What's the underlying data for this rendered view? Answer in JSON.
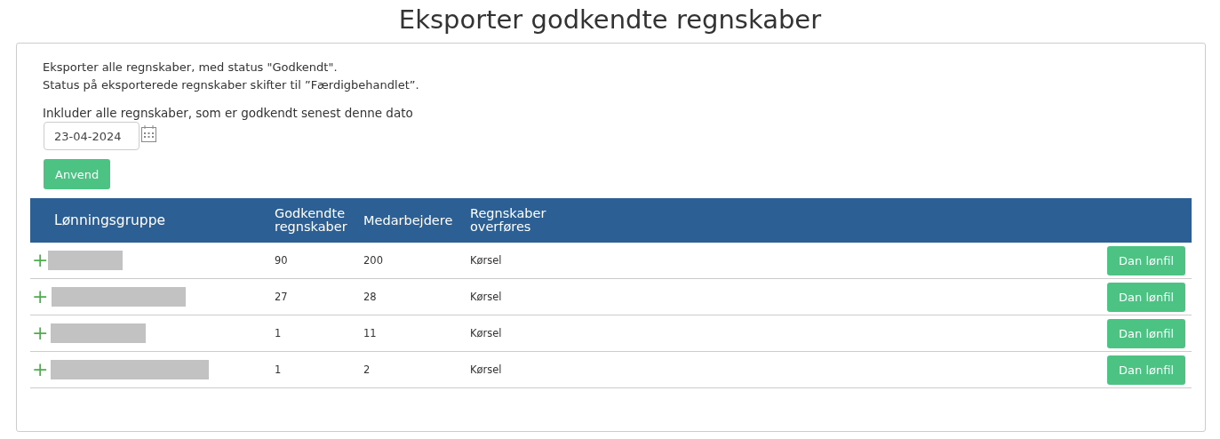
{
  "title": "Eksporter godkendte regnskaber",
  "intro": [
    "Eksporter alle regnskaber, med status \"Godkendt\".",
    "Status på eksporterede regnskaber skifter til ”Færdigbehandlet”."
  ],
  "date_label": "Inkluder alle regnskaber, som er godkendt senest denne dato",
  "date_field": {
    "value": "23-04-2024"
  },
  "apply_button": "Anvend",
  "table": {
    "columns": [
      "Lønningsgruppe",
      "Godkendte regnskaber",
      "Medarbejdere",
      "Regnskaber overføres"
    ],
    "rows": [
      {
        "expand": "+",
        "approved": "90",
        "employees": "200",
        "transfer": "Kørsel",
        "action": "Dan lønfil"
      },
      {
        "expand": "+",
        "approved": "27",
        "employees": "28",
        "transfer": "Kørsel",
        "action": "Dan lønfil"
      },
      {
        "expand": "+",
        "approved": "1",
        "employees": "11",
        "transfer": "Kørsel",
        "action": "Dan lønfil"
      },
      {
        "expand": "+",
        "approved": "1",
        "employees": "2",
        "transfer": "Kørsel",
        "action": "Dan lønfil"
      }
    ]
  }
}
